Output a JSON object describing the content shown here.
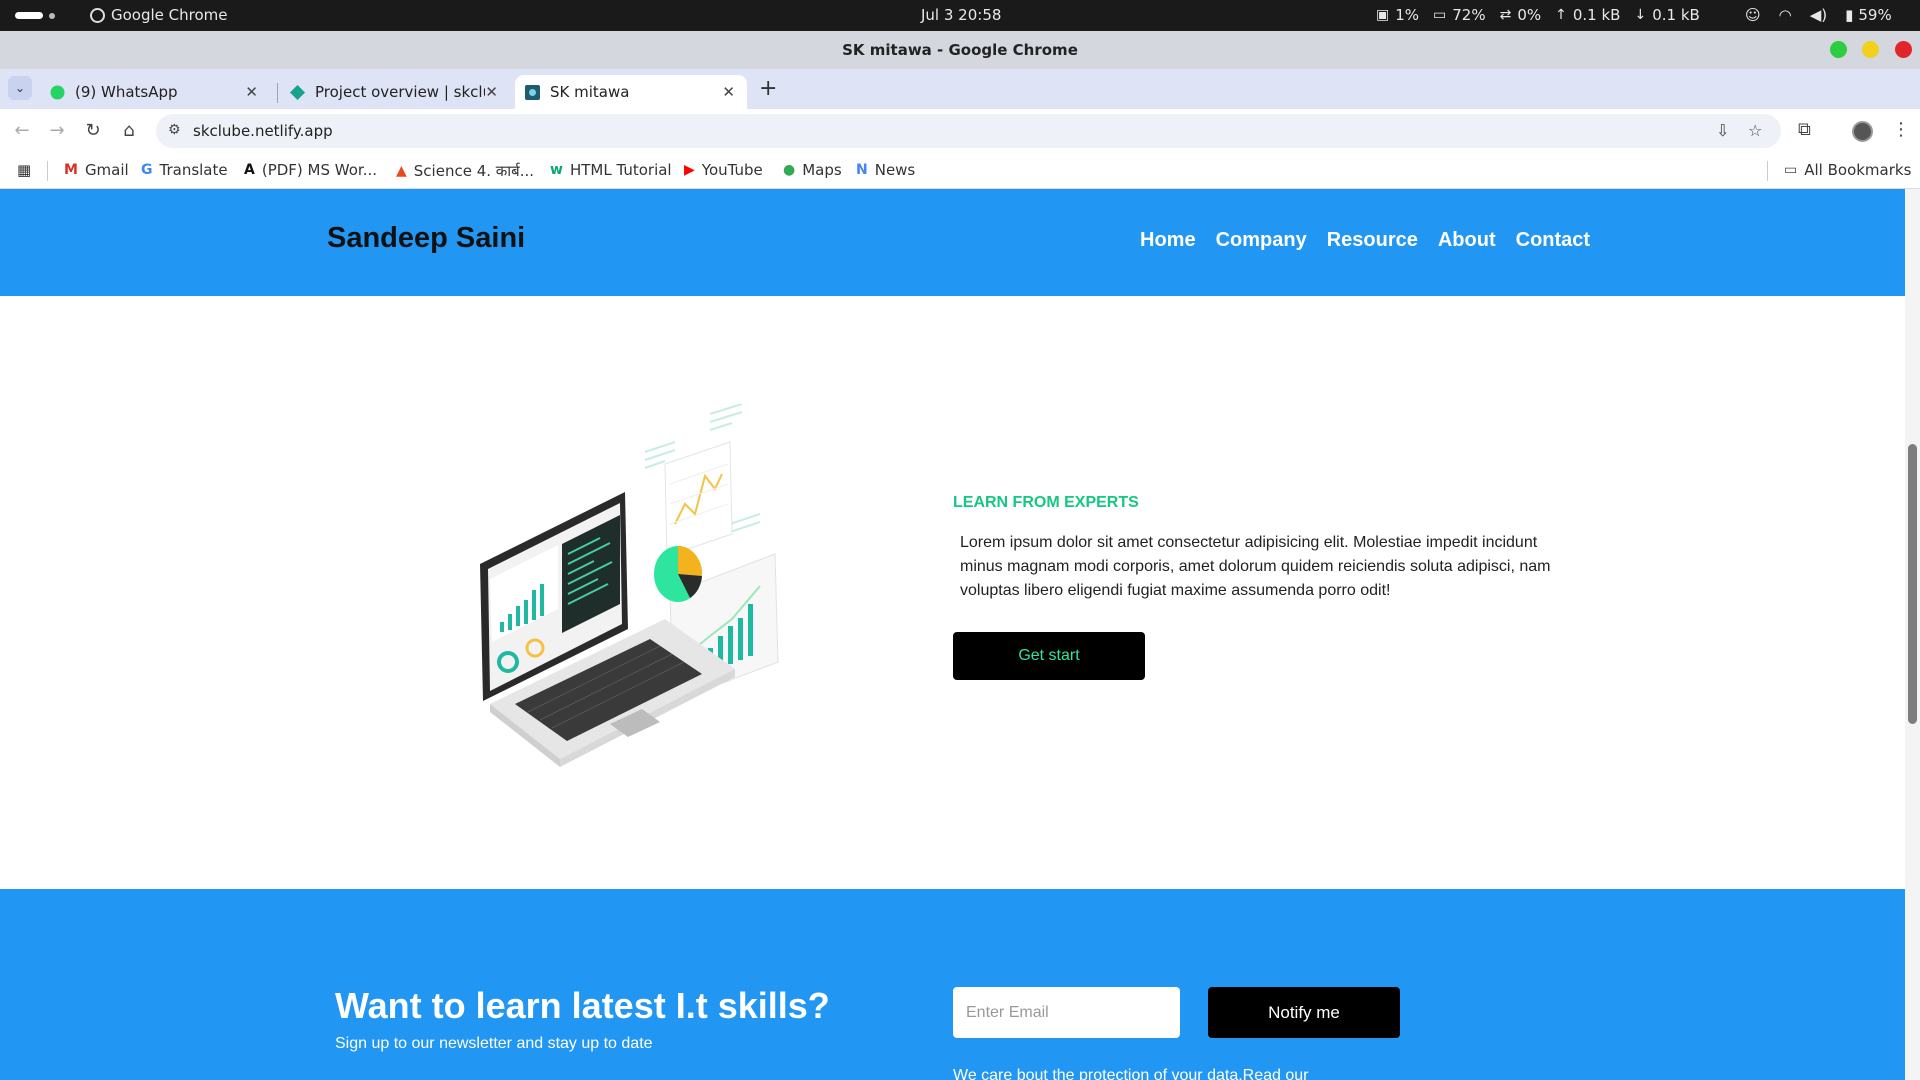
{
  "os": {
    "app_name": "Google Chrome",
    "clock": "Jul 3  20:58",
    "stats": [
      {
        "icon": "cpu-icon",
        "glyph": "▣",
        "value": "1%"
      },
      {
        "icon": "memory-icon",
        "glyph": "▭",
        "value": "72%"
      },
      {
        "icon": "swap-icon",
        "glyph": "⇄",
        "value": "0%"
      },
      {
        "icon": "upload-icon",
        "glyph": "↑",
        "value": "0.1 kB"
      },
      {
        "icon": "download-icon",
        "glyph": "↓",
        "value": "0.1 kB"
      }
    ],
    "battery": "59%"
  },
  "window": {
    "title": "SK mitawa - Google Chrome"
  },
  "tabs": [
    {
      "label": "(9) WhatsApp",
      "color": "#25d366"
    },
    {
      "label": "Project overview | skclube",
      "color": "#15a28e"
    },
    {
      "label": "SK mitawa",
      "color": "#1e5c6e"
    }
  ],
  "toolbar": {
    "url": "skclube.netlify.app"
  },
  "bookmarks": [
    {
      "label": "Gmail",
      "glyph": "M",
      "color": "#d93025"
    },
    {
      "label": "Translate",
      "glyph": "G",
      "color": "#4285f4"
    },
    {
      "label": "(PDF) MS Wor...",
      "glyph": "A",
      "color": "#111"
    },
    {
      "label": "Science 4. कार्ब...",
      "glyph": "▲",
      "color": "#e8491d"
    },
    {
      "label": "HTML Tutorial",
      "glyph": "w",
      "color": "#04aa6d"
    },
    {
      "label": "YouTube",
      "glyph": "▶",
      "color": "#ff0000"
    },
    {
      "label": "Maps",
      "glyph": "●",
      "color": "#34a853"
    },
    {
      "label": "News",
      "glyph": "N",
      "color": "#4285f4"
    }
  ],
  "all_bookmarks": "All Bookmarks",
  "site": {
    "brand": "Sandeep Saini",
    "nav": [
      "Home",
      "Company",
      "Resource",
      "About",
      "Contact"
    ],
    "eyebrow": "LEARN FROM EXPERTS",
    "hero_text": "Lorem ipsum dolor sit amet consectetur adipisicing elit. Molestiae impedit incidunt minus magnam modi corporis, amet dolorum quidem reiciendis soluta adipisci, nam voluptas libero eligendi fugiat maxime assumenda porro odit!",
    "cta": "Get start",
    "newsletter": {
      "title": "Want to learn latest I.t skills?",
      "subtitle": "Sign up to our newsletter and stay up to date",
      "email_placeholder": "Enter Email",
      "button": "Notify me",
      "note": "We care bout the protection of your data.Read our"
    }
  },
  "colors": {
    "brand_blue": "#2196f3",
    "accent_green": "#16c784"
  }
}
